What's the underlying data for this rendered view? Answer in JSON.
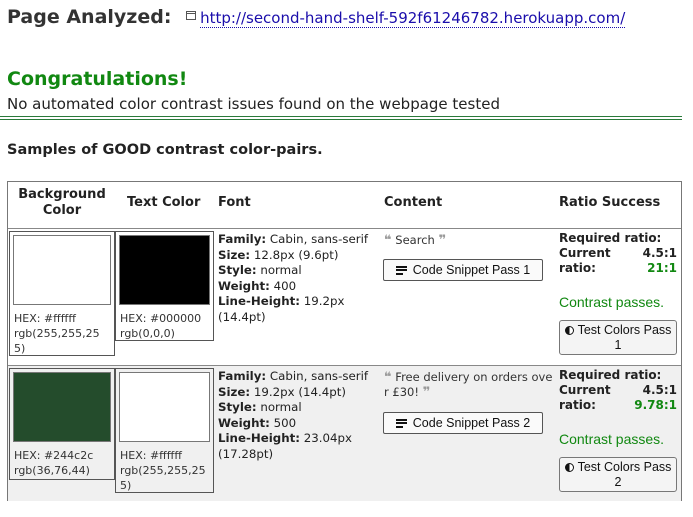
{
  "header": {
    "title": "Page Analyzed:",
    "url": "http://second-hand-shelf-592f61246782.herokuapp.com/"
  },
  "result": {
    "heading": "Congratulations!",
    "message": "No automated color contrast issues found on the webpage tested"
  },
  "samples_heading": "Samples of GOOD contrast color-pairs.",
  "table": {
    "headers": {
      "background": "Background Color",
      "text_color": "Text Color",
      "font": "Font",
      "content": "Content",
      "ratio": "Ratio Success"
    },
    "rows": [
      {
        "bg": {
          "color": "#ffffff",
          "hex": "HEX: #ffffff",
          "rgb": "rgb(255,255,255)"
        },
        "fg": {
          "color": "#000000",
          "hex": "HEX: #000000",
          "rgb": "rgb(0,0,0)"
        },
        "font": {
          "family_label": "Family:",
          "family": "Cabin, sans-serif",
          "size_label": "Size:",
          "size": "12.8px (9.6pt)",
          "style_label": "Style:",
          "style": "normal",
          "weight_label": "Weight:",
          "weight": "400",
          "lh_label": "Line-Height:",
          "lh": "19.2px (14.4pt)"
        },
        "content": {
          "text": "Search",
          "snippet_button": "Code Snippet Pass 1"
        },
        "ratio": {
          "required_label": "Required ratio:",
          "current_label": "Current ratio:",
          "required": "4.5:1",
          "current": "21:1",
          "pass": "Contrast passes.",
          "test_button": "Test Colors Pass 1"
        }
      },
      {
        "bg": {
          "color": "#244c2c",
          "hex": "HEX: #244c2c",
          "rgb": "rgb(36,76,44)"
        },
        "fg": {
          "color": "#ffffff",
          "hex": "HEX: #ffffff",
          "rgb": "rgb(255,255,255)"
        },
        "font": {
          "family_label": "Family:",
          "family": "Cabin, sans-serif",
          "size_label": "Size:",
          "size": "19.2px (14.4pt)",
          "style_label": "Style:",
          "style": "normal",
          "weight_label": "Weight:",
          "weight": "500",
          "lh_label": "Line-Height:",
          "lh": "23.04px (17.28pt)"
        },
        "content": {
          "text": "Free delivery on orders over £30!",
          "snippet_button": "Code Snippet Pass 2"
        },
        "ratio": {
          "required_label": "Required ratio:",
          "current_label": "Current ratio:",
          "required": "4.5:1",
          "current": "9.78:1",
          "pass": "Contrast passes.",
          "test_button": "Test Colors Pass 2"
        }
      }
    ]
  },
  "colors": {
    "accent_green": "#118811",
    "link": "#1a0dab"
  }
}
